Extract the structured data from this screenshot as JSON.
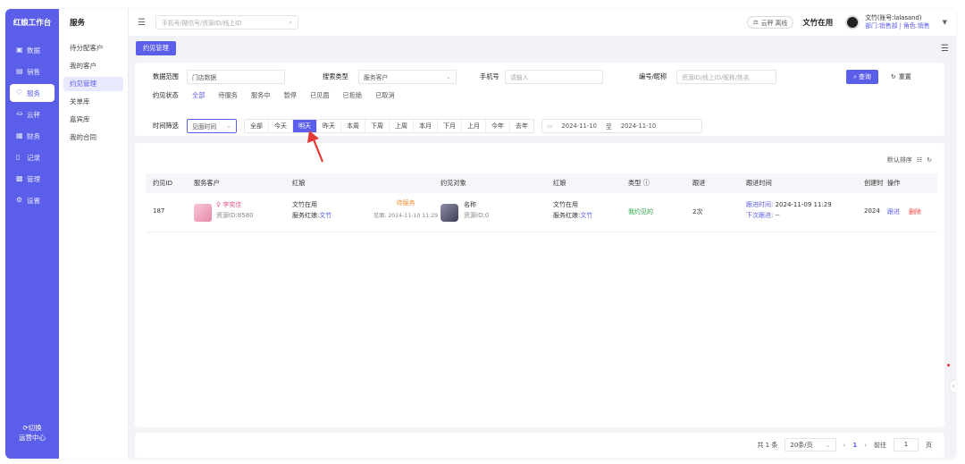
{
  "nav": {
    "brand": "红娘工作台",
    "items": [
      {
        "label": "数据",
        "icon": "data-icon"
      },
      {
        "label": "销售",
        "icon": "sales-icon"
      },
      {
        "label": "服务",
        "icon": "heart-icon"
      },
      {
        "label": "云秤",
        "icon": "scale-icon"
      },
      {
        "label": "财务",
        "icon": "finance-icon"
      },
      {
        "label": "记录",
        "icon": "record-icon"
      },
      {
        "label": "管理",
        "icon": "manage-icon"
      },
      {
        "label": "设置",
        "icon": "settings-icon"
      }
    ],
    "switch_line1": "切换",
    "switch_line2": "运营中心"
  },
  "subnav": {
    "title": "服务",
    "items": [
      "待分配客户",
      "我的客户",
      "约见管理",
      "关单库",
      "嘉宾库",
      "我的合同"
    ]
  },
  "topbar": {
    "search_placeholder": "手机号/微信号/资源ID/线上ID",
    "cloud_status": "云秤 离线",
    "user_name": "文竹在用",
    "user_account": "文竹(账号:lalasand)",
    "user_dept": "部门:销售部 | 角色:销售"
  },
  "tabs": [
    "约见管理"
  ],
  "filters": {
    "scope_label": "数据范围",
    "scope_value": "门店数据",
    "search_type_label": "搜索类型",
    "search_type_value": "服务客户",
    "phone_label": "手机号",
    "phone_placeholder": "请输入",
    "code_label": "编号/昵称",
    "code_placeholder": "资源ID/线上ID/昵称/姓名",
    "query_button": "查询",
    "reset_button": "重置",
    "status_label": "约见状态",
    "statuses": [
      "全部",
      "待服务",
      "服务中",
      "暂停",
      "已见面",
      "已拒绝",
      "已取消"
    ],
    "time_label": "时间筛选",
    "time_type": "见面时间",
    "time_ranges": [
      "全部",
      "今天",
      "明天",
      "昨天",
      "本周",
      "下周",
      "上周",
      "本月",
      "下月",
      "上月",
      "今年",
      "去年"
    ],
    "active_range": "明天",
    "date_from": "2024-11-10",
    "date_sep": "至",
    "date_to": "2024-11-10"
  },
  "table": {
    "sort_label": "默认排序",
    "headers": [
      "约见ID",
      "服务客户",
      "红娘",
      "约见对象",
      "红娘",
      "类型",
      "跟进",
      "跟进时间",
      "创建时",
      "操作"
    ],
    "rows": [
      {
        "id": "187",
        "customer_name": "李奕佳",
        "customer_res": "资源ID:8580",
        "matchmaker": "文竹在用",
        "matchmaker_service": "服务红娘:",
        "matchmaker_service_name": "文竹",
        "status": "待服务",
        "meet_time": "见面: 2024-11-10 11:29",
        "target_name": "名称",
        "target_res": "资源ID:0",
        "matchmaker2": "文竹在用",
        "matchmaker2_service": "服务红娘:",
        "matchmaker2_service_name": "文竹",
        "type": "我约见的",
        "followups": "2次",
        "follow_time_label": "跟进时间:",
        "follow_time": "2024-11-09 11:29",
        "next_follow_label": "下次跟进:",
        "next_follow": "--",
        "created": "2024",
        "action_follow": "跟进",
        "action_delete": "删除"
      }
    ]
  },
  "pagination": {
    "total": "共 1 条",
    "page_size": "20条/页",
    "current": "1",
    "goto_label": "前往",
    "goto_value": "1",
    "page_unit": "页"
  },
  "colors": {
    "brand": "#5b5ee8",
    "annotation": "#e53935"
  }
}
